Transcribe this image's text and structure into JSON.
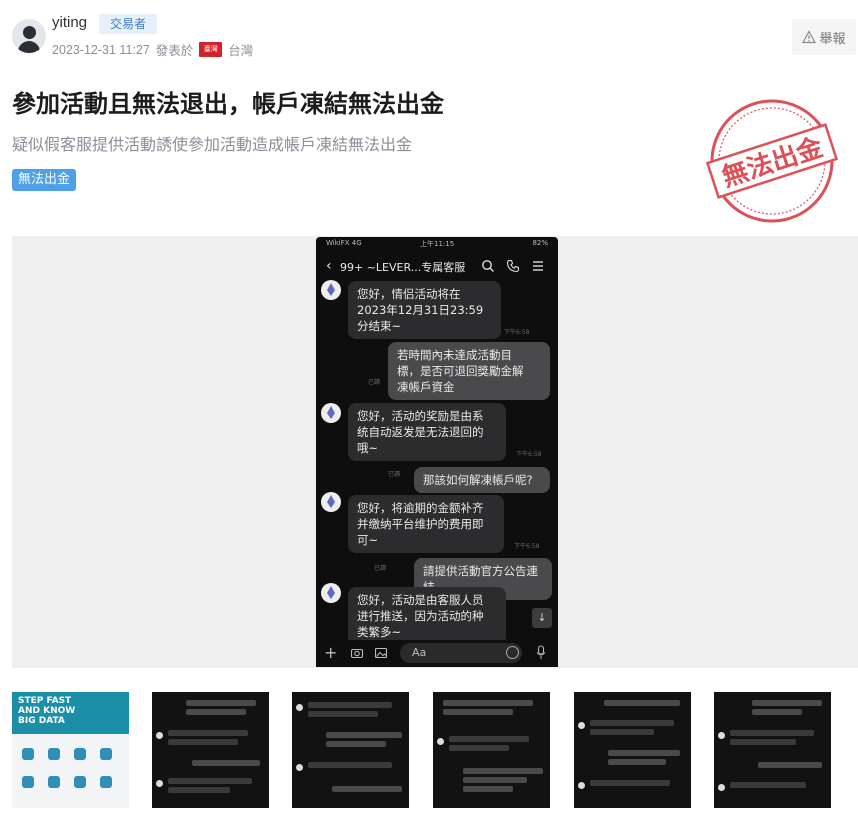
{
  "author": {
    "username": "yiting",
    "role_badge": "交易者",
    "date": "2023-12-31 11:27",
    "posted_from": "發表於",
    "region": "台灣",
    "flag_text": "臺灣"
  },
  "actions": {
    "report_label": "舉報"
  },
  "post": {
    "title": "參加活動且無法退出，帳戶凍結無法出金",
    "description": "疑似假客服提供活動誘使參加活動造成帳戶凍結無法出金",
    "tag": "無法出金",
    "stamp_text": "無法出金"
  },
  "screenshot": {
    "status_left": "WikiFX 4G",
    "status_time": "上午11:15",
    "status_battery": "82%",
    "chat_name": "99+  ~LEVER...专属客服",
    "input_placeholder": "Aa",
    "messages": [
      {
        "side": "in",
        "text": "您好，情侣活动将在\n2023年12月31日23:59\n分结束~",
        "time": "下午6:58"
      },
      {
        "side": "out",
        "text": "若時間內未達成活動目\n標，是否可退回獎勵金解\n凍帳戶資金",
        "time": "已讀"
      },
      {
        "side": "in",
        "text": "您好，活动的奖励是由系\n统自动返发是无法退回的\n哦~",
        "time": "下午6:58"
      },
      {
        "side": "out",
        "text": "那該如何解凍帳戶呢?",
        "time": "已讀"
      },
      {
        "side": "in",
        "text": "您好，将逾期的金额补齐\n并缴纳平台维护的费用即\n可~",
        "time": "下午6:58"
      },
      {
        "side": "out",
        "text": "請提供活動官方公告連結",
        "time": "已讀"
      },
      {
        "side": "in",
        "text": "您好，活动是由客服人员\n进行推送，因为活动的种\n类繁多~",
        "time": ""
      }
    ]
  },
  "thumbnails": {
    "ad_text": "STEP FAST\nAND KNOW\nBIG DATA",
    "count": 6
  },
  "colors": {
    "badge_bg": "#e6f0fb",
    "badge_text": "#3b7bd4",
    "tag_bg": "#4ea0e8",
    "stamp": "#d8323a",
    "phone_bg": "#0e0e0f"
  }
}
